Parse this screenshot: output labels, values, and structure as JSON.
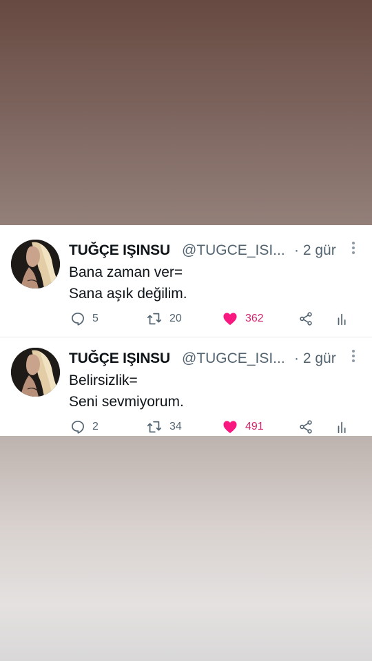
{
  "tweets": [
    {
      "name": "TUĞÇE IŞINSU",
      "handle": "@TUGCE_ISI...",
      "time": "· 2 gür",
      "lines": [
        "Bana zaman ver=",
        "Sana aşık değilim."
      ],
      "replies": "5",
      "retweets": "20",
      "likes": "362"
    },
    {
      "name": "TUĞÇE IŞINSU",
      "handle": "@TUGCE_ISI...",
      "time": "· 2 gür",
      "lines": [
        "Belirsizlik=",
        "Seni sevmiyorum."
      ],
      "replies": "2",
      "retweets": "34",
      "likes": "491"
    }
  ],
  "icons": {
    "reply": "speech-bubble-icon",
    "retweet": "retweet-icon",
    "like": "heart-icon",
    "share": "share-icon",
    "stats": "bar-chart-icon",
    "more": "vertical-dots-icon"
  },
  "colors": {
    "like_active": "#f91880",
    "like_count": "#d4246d",
    "secondary_text": "#536471",
    "primary_text": "#0f1419"
  }
}
